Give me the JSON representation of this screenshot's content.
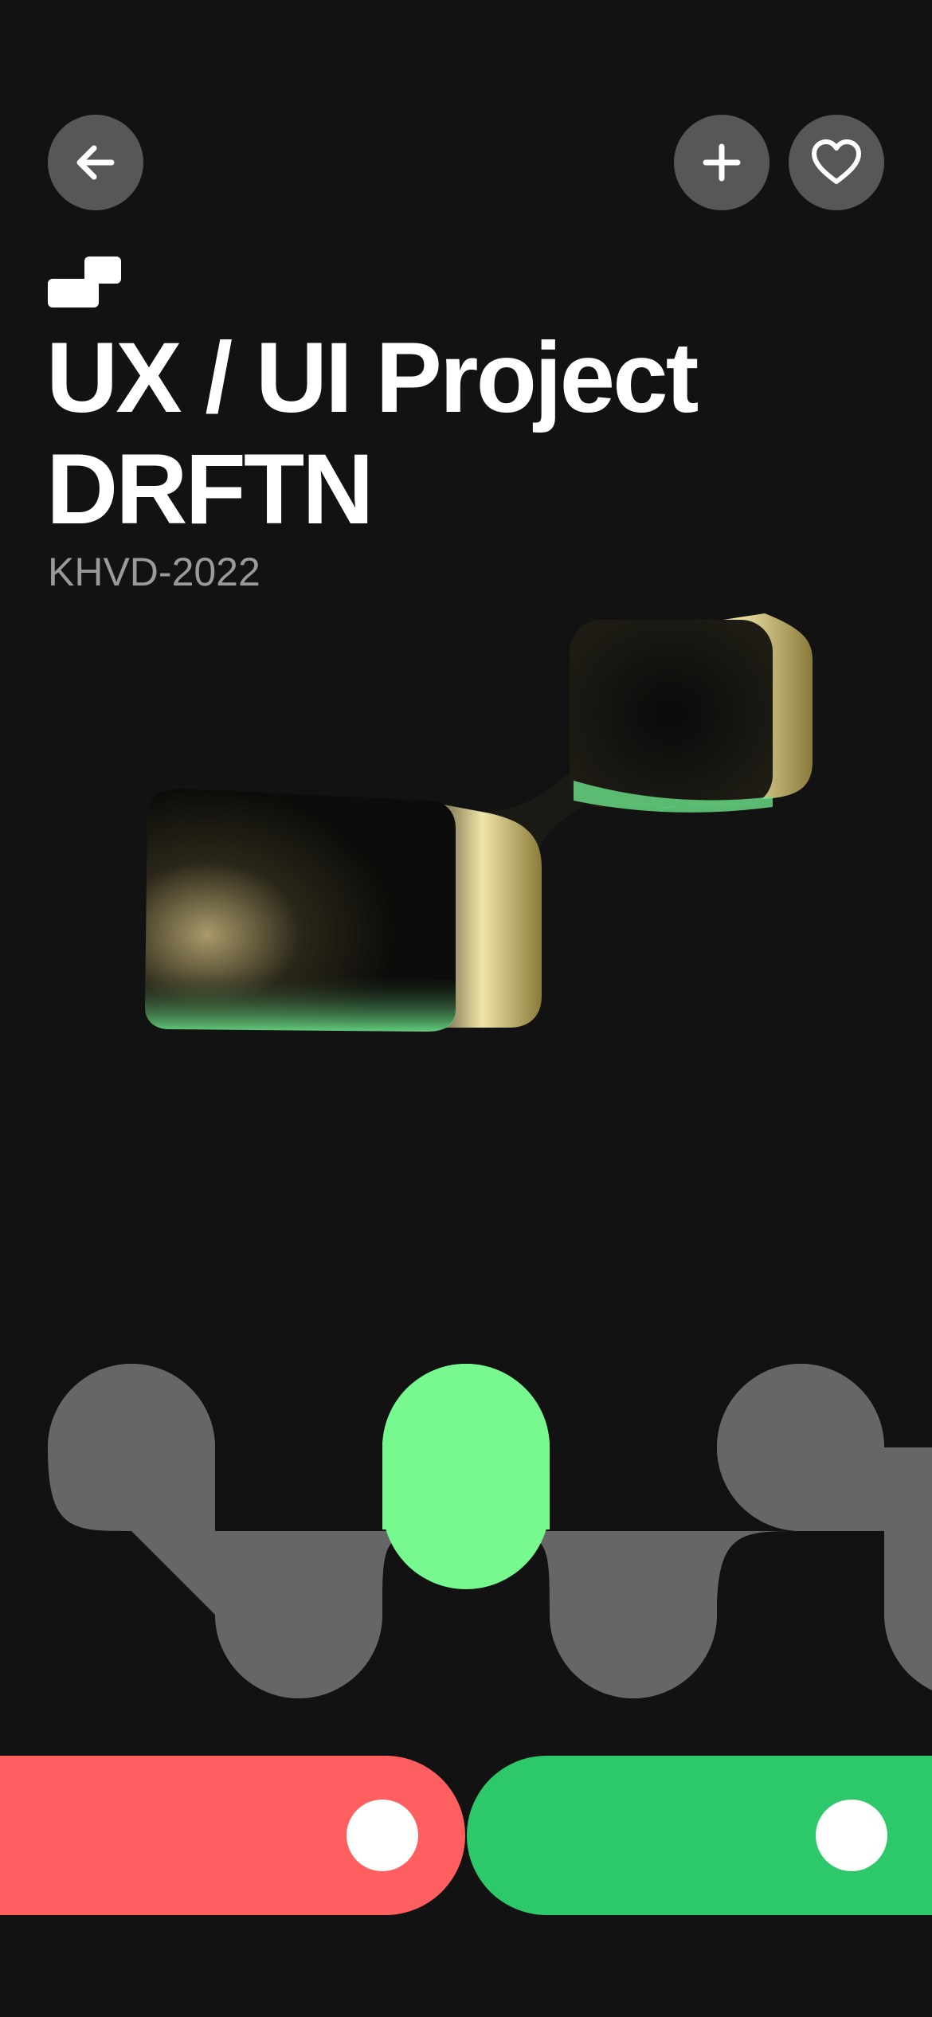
{
  "header": {
    "back_icon": "arrow-left-icon",
    "add_icon": "plus-icon",
    "favorite_icon": "heart-icon"
  },
  "project": {
    "title_line1": "UX / UI Project",
    "title_line2": "DRFTN",
    "code": "KHVD-2022"
  },
  "colors": {
    "background": "#121212",
    "button_bg": "#575757",
    "wave_gray": "#666666",
    "accent_green": "#77F98F",
    "toggle_red": "#FF5F5F",
    "toggle_green": "#2DC86A",
    "knob": "#FFFFFF"
  },
  "toggles": [
    {
      "name": "left-toggle",
      "color": "#FF5F5F"
    },
    {
      "name": "right-toggle",
      "color": "#2DC86A"
    }
  ]
}
